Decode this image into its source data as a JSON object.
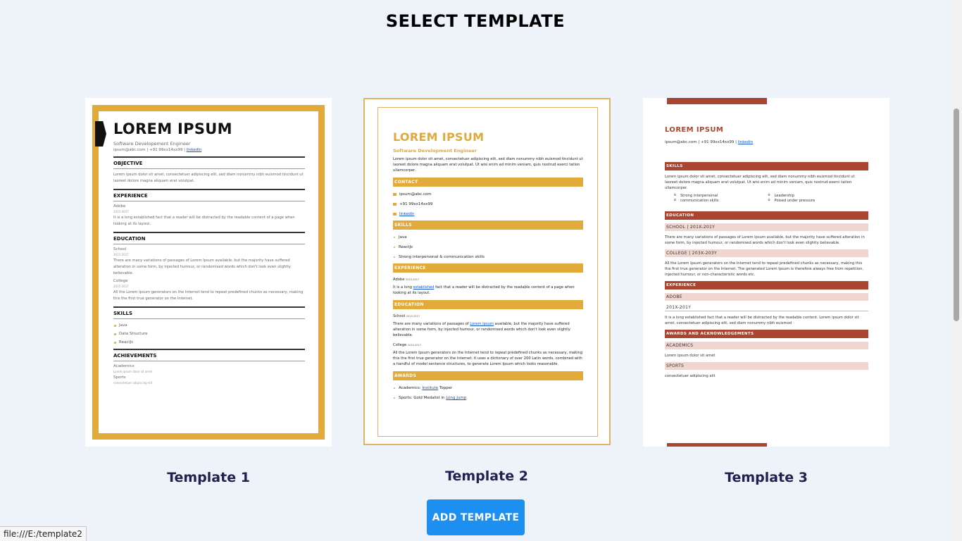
{
  "page": {
    "title": "SELECT TEMPLATE"
  },
  "templates": [
    {
      "label": "Template 1"
    },
    {
      "label": "Template 2"
    },
    {
      "label": "Template 3"
    }
  ],
  "add_button": {
    "label": "ADD TEMPLATE"
  },
  "status_bar": {
    "url": "file:///E:/template2"
  },
  "colors": {
    "accent_gold": "#e2a93b",
    "accent_rust": "#a94530",
    "button_blue": "#1c8ff0",
    "label_navy": "#1f2150"
  },
  "t1": {
    "name": "LOREM IPSUM",
    "role": "Software Developement Engineer",
    "contact": "ipsum@abc.com | +91 99xx14xx99 | ",
    "contact_link": "linkedIn",
    "objective_title": "OBJECTIVE",
    "objective_text": "Lorem ipsum dolor sit amet, consectetuer adipiscing elit, sed diam nonummy nibh euismod tincidunt ut laoreet dolore magna aliquam erat volutpat.",
    "experience_title": "EXPERIENCE",
    "exp_company": "Adobe",
    "exp_date": "2015-2017",
    "exp_text": "It is a long established fact that a reader will be distracted by the readable content of a page when looking at its layout.",
    "education_title": "EDUCATION",
    "edu1_name": "School",
    "edu1_date": "2015-2017",
    "edu1_text": "There are many variations of passages of Lorem Ipsum available, but the majority have suffered alteration in some form, by injected humour, or randomised words which don't look even slightly believable.",
    "edu2_name": "College",
    "edu2_date": "2015-2017",
    "edu2_text": "All the Lorem Ipsum generators on the Internet tend to repeat predefined chunks as necessary, making this the first true generator on the Internet.",
    "skills_title": "SKILLS",
    "skills": [
      "Java",
      "Data Structure",
      "ReactJs"
    ],
    "achievements_title": "ACHIEVEMENTS",
    "ach1_title": "Academics",
    "ach1_text": "Lorem ipsum dolor sit amet",
    "ach2_title": "Sports",
    "ach2_text": "consectetuer adipiscing elit"
  },
  "t2": {
    "name": "LOREM IPSUM",
    "role": "Software Development Engineer",
    "intro": "Lorem ipsum dolor sit amet, consectetuer adipiscing elit, sed diam nonummy nibh euismod tincidunt ut laoreet dolore magna aliquam erat volutpat. Ut wisi enim ad minim veniam, quis nostrud exerci tation ullamcorper.",
    "contact_title": "CONTACT",
    "email": "ipsum@abc.com",
    "phone": "+91 99xx14xx99",
    "linkedin": "linkedIn",
    "skills_title": "SKILLS",
    "skills": [
      "Java",
      "ReactJs",
      "Strong interpersonal & communication skills"
    ],
    "experience_title": "EXPERIENCE",
    "exp_company": "Adobe",
    "exp_date": "2015-2017",
    "exp_text_a": "It is a long ",
    "exp_text_link": "established",
    "exp_text_b": " fact that a reader will be distracted by the readable content of a page when looking at its layout.",
    "education_title": "EDUCATION",
    "edu1_name": "School",
    "edu1_date": "2015-2017",
    "edu1_text_a": "There are many variations of passages of ",
    "edu1_text_link": "Lorem Ipsum",
    "edu1_text_b": " available, but the majority have suffered alteration in some form, by injected humour, or randomised words which don't look even slightly believable.",
    "edu2_name": "College",
    "edu2_date": "2015-2017",
    "edu2_text": "All the Lorem Ipsum generators on the Internet tend to repeat predefined chunks as necessary, making this the first true generator on the Internet. It uses a dictionary of over 200 Latin words, combined with a handful of model sentence structures, to generate Lorem Ipsum which looks reasonable.",
    "awards_title": "AWARDS",
    "award1_a": "Academics: ",
    "award1_link": "Institute",
    "award1_b": " Topper",
    "award2_a": "Sports: Gold Medalist in ",
    "award2_link": "Long Jump"
  },
  "t3": {
    "name": "LOREM IPSUM",
    "contact": "ipsum@abc.com | +91 99xx14xx99 | ",
    "contact_link": "linkedin",
    "skills_title": "SKILLS",
    "skills_text": "Lorem ipsum dolor sit amet, consectetuer adipiscing elit, sed diam nonummy nibh euismod tincidunt ut laoreet dolore magna aliquam erat volutpat. Ut wisi enim ad minim veniam, quis nostrud exerci tation ullamcorper.",
    "skills": [
      "Strong interpersonal",
      "Leadership",
      "communication skills",
      "Poised under pressure"
    ],
    "education_title": "EDUCATION",
    "school_row": "SCHOOL | 201X-201Y",
    "school_text": "There are many variations of passages of Lorem Ipsum available, but the majority have suffered alteration in some form, by injected humour, or randomised words which don't look even slightly believable.",
    "college_row": "COLLEGE | 203X-203Y",
    "college_text": "All the Lorem Ipsum generators on the Internet tend to repeat predefined chunks as necessary, making this the first true generator on the Internet. The generated Lorem Ipsum is therefore always free from repetition, injected humour, or non-characteristic words etc.",
    "experience_title": "EXPERIENCE",
    "company_row": "ADOBE",
    "years_row": "201X-201Y",
    "exp_text": "It is a long established fact that a reader will be distracted by the readable content. Lorem ipsum dolor sit amet, consectetuer adipiscing elit, sed diam nonummy nibh euismod",
    "awards_title": "AWARDS AND ACKNOWLEDGEMENTS",
    "academics_row": "ACADEMICS",
    "academics_text": "Lorem ipsum dolor sit amet",
    "sports_row": "SPORTS",
    "sports_text": "consectetuer adipiscing elit"
  }
}
